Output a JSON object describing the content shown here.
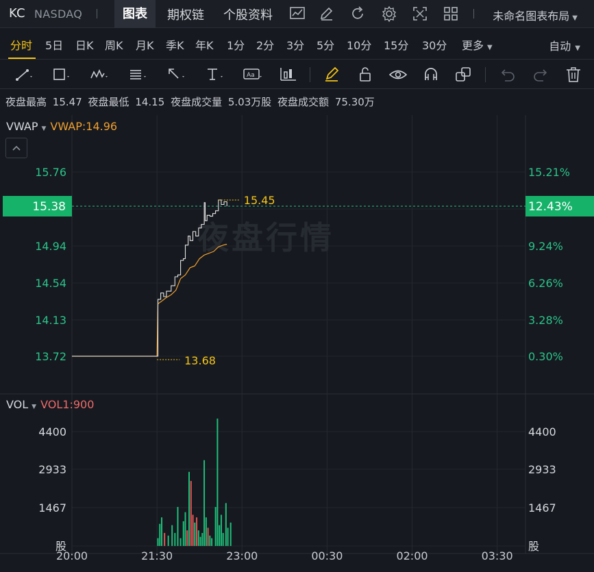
{
  "header": {
    "symbol": "KC",
    "exchange": "NASDAQ",
    "tabs": [
      {
        "label": "图表",
        "active": true
      },
      {
        "label": "期权链",
        "active": false
      },
      {
        "label": "个股资料",
        "active": false
      }
    ],
    "icons": [
      "chart-line-icon",
      "edit-icon",
      "refresh-icon",
      "settings-gear-icon",
      "fullscreen-icon",
      "grid-layout-icon"
    ],
    "layout_name": "未命名图表布局"
  },
  "periods": {
    "items": [
      "分时",
      "5日",
      "日K",
      "周K",
      "月K",
      "季K",
      "年K",
      "1分",
      "2分",
      "3分",
      "5分",
      "10分",
      "15分",
      "30分",
      "更多"
    ],
    "active": "分时",
    "right_mode": "自动"
  },
  "toolbar": {
    "tools": [
      "line-tool-icon",
      "rectangle-tool-icon",
      "wave-tool-icon",
      "fib-tool-icon",
      "arrow-tool-icon",
      "text-tool-icon",
      "note-tool-icon",
      "pattern-tool-icon",
      "brush-icon",
      "lock-icon",
      "eye-icon",
      "magnet-icon",
      "layers-icon",
      "undo-icon",
      "redo-icon",
      "trash-icon"
    ]
  },
  "stats": {
    "high_label": "夜盘最高",
    "high_value": "15.47",
    "low_label": "夜盘最低",
    "low_value": "14.15",
    "volume_label": "夜盘成交量",
    "volume_value": "5.03万股",
    "amount_label": "夜盘成交额",
    "amount_value": "75.30万"
  },
  "main_pane": {
    "indicator": "VWAP",
    "indicator_value": "VWAP:14.96",
    "watermark": "夜盘行情",
    "left_ticks": [
      "15.76",
      "14.94",
      "14.54",
      "14.13",
      "13.72"
    ],
    "right_ticks": [
      "15.21%",
      "9.24%",
      "6.26%",
      "3.28%",
      "0.30%"
    ],
    "current_price": "15.38",
    "current_pct": "12.43%",
    "high_marker": "15.45",
    "low_marker": "13.68",
    "colors": {
      "price_line": "#e6e6e6",
      "vwap_line": "#f0a030",
      "axis_text": "#2bc48a",
      "badge": "#17b26a",
      "marker": "#f5c518"
    }
  },
  "volume_pane": {
    "indicator": "VOL",
    "indicator_value": "VOL1:900",
    "left_ticks": [
      "4400",
      "2933",
      "1467",
      "股"
    ],
    "right_ticks": [
      "4400",
      "2933",
      "1467",
      "股"
    ],
    "colors": {
      "up": "#1fbf7a",
      "down": "#e35757"
    }
  },
  "time_axis": [
    "20:00",
    "21:30",
    "23:00",
    "00:30",
    "02:00",
    "03:30"
  ],
  "chart_data": {
    "type": "line",
    "title": "",
    "x_unit": "time (HH:MM)",
    "ylim": [
      13.5,
      16.0
    ],
    "series": [
      {
        "name": "",
        "values_hint": "price",
        "points": [
          [
            "20:00",
            13.72
          ],
          [
            "21:30",
            13.72
          ],
          [
            "21:31",
            14.35
          ],
          [
            "21:34",
            14.42
          ],
          [
            "21:37",
            14.38
          ],
          [
            "21:40",
            14.44
          ],
          [
            "21:45",
            14.5
          ],
          [
            "21:49",
            14.6
          ],
          [
            "21:52",
            14.62
          ],
          [
            "21:55",
            14.78
          ],
          [
            "21:58",
            14.8
          ],
          [
            "22:00",
            14.95
          ],
          [
            "22:03",
            15.05
          ],
          [
            "22:05",
            15.0
          ],
          [
            "22:08",
            15.1
          ],
          [
            "22:11",
            15.05
          ],
          [
            "22:14",
            15.14
          ],
          [
            "22:17",
            15.18
          ],
          [
            "22:20",
            15.42
          ],
          [
            "22:21",
            15.22
          ],
          [
            "22:23",
            15.28
          ],
          [
            "22:26",
            15.27
          ],
          [
            "22:29",
            15.3
          ],
          [
            "22:32",
            15.33
          ],
          [
            "22:35",
            15.45
          ],
          [
            "22:38",
            15.4
          ],
          [
            "22:41",
            15.43
          ],
          [
            "22:44",
            15.38
          ]
        ]
      },
      {
        "name": "VWAP",
        "values_hint": "vwap",
        "points": [
          [
            "20:00",
            13.72
          ],
          [
            "21:30",
            13.72
          ],
          [
            "21:31",
            14.3
          ],
          [
            "21:35",
            14.33
          ],
          [
            "21:40",
            14.37
          ],
          [
            "21:45",
            14.4
          ],
          [
            "21:50",
            14.45
          ],
          [
            "21:55",
            14.58
          ],
          [
            "22:00",
            14.62
          ],
          [
            "22:05",
            14.7
          ],
          [
            "22:10",
            14.72
          ],
          [
            "22:15",
            14.8
          ],
          [
            "22:20",
            14.84
          ],
          [
            "22:25",
            14.86
          ],
          [
            "22:30",
            14.88
          ],
          [
            "22:35",
            14.93
          ],
          [
            "22:40",
            14.95
          ],
          [
            "22:44",
            14.96
          ]
        ]
      }
    ],
    "volume": {
      "ylim": [
        0,
        4800
      ],
      "bars": [
        [
          "21:31",
          300,
          "up"
        ],
        [
          "21:33",
          850,
          "up"
        ],
        [
          "21:35",
          1100,
          "up"
        ],
        [
          "21:38",
          500,
          "down"
        ],
        [
          "21:42",
          400,
          "up"
        ],
        [
          "21:46",
          800,
          "up"
        ],
        [
          "21:49",
          500,
          "up"
        ],
        [
          "21:52",
          1500,
          "up"
        ],
        [
          "21:55",
          300,
          "up"
        ],
        [
          "21:58",
          950,
          "up"
        ],
        [
          "22:00",
          1300,
          "up"
        ],
        [
          "22:02",
          600,
          "down"
        ],
        [
          "22:04",
          2850,
          "up"
        ],
        [
          "22:06",
          2500,
          "down"
        ],
        [
          "22:08",
          1200,
          "down"
        ],
        [
          "22:10",
          900,
          "up"
        ],
        [
          "22:12",
          1100,
          "down"
        ],
        [
          "22:14",
          600,
          "up"
        ],
        [
          "22:16",
          350,
          "up"
        ],
        [
          "22:18",
          500,
          "up"
        ],
        [
          "22:20",
          3300,
          "up"
        ],
        [
          "22:22",
          1100,
          "up"
        ],
        [
          "22:24",
          700,
          "down"
        ],
        [
          "22:26",
          400,
          "up"
        ],
        [
          "22:28",
          300,
          "up"
        ],
        [
          "22:32",
          1500,
          "up"
        ],
        [
          "22:34",
          4900,
          "up"
        ],
        [
          "22:36",
          800,
          "up"
        ],
        [
          "22:38",
          1200,
          "up"
        ],
        [
          "22:40",
          500,
          "up"
        ],
        [
          "22:43",
          1650,
          "up"
        ],
        [
          "22:45",
          700,
          "up"
        ],
        [
          "22:48",
          900,
          "up"
        ]
      ]
    }
  }
}
